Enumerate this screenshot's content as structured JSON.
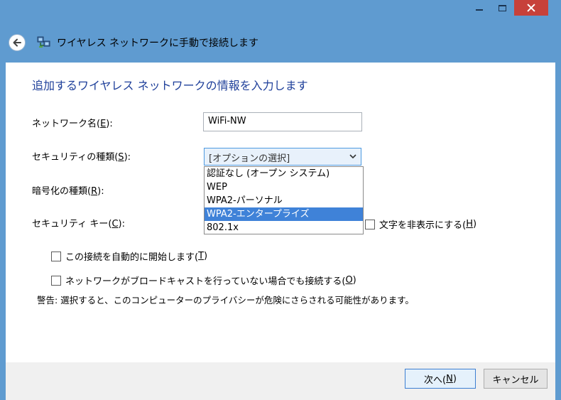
{
  "window": {
    "title": "ワイヤレス ネットワークに手動で接続します"
  },
  "content": {
    "heading": "追加するワイヤレス ネットワークの情報を入力します",
    "network_name": {
      "label_pre": "ネットワーク名(",
      "mnemonic": "E",
      "label_post": "):",
      "value": "WiFi-NW"
    },
    "security_type": {
      "label_pre": "セキュリティの種類(",
      "mnemonic": "S",
      "label_post": "):",
      "value": "[オプションの選択]",
      "options": [
        "認証なし (オープン システム)",
        "WEP",
        "WPA2-パーソナル",
        "WPA2-エンタープライズ",
        "802.1x"
      ],
      "highlighted_index": 3
    },
    "encryption_type": {
      "label_pre": "暗号化の種類(",
      "mnemonic": "R",
      "label_post": "):"
    },
    "security_key": {
      "label_pre": "セキュリティ キー(",
      "mnemonic": "C",
      "label_post": "):"
    },
    "hide_chars": {
      "label_pre": "文字を非表示にする(",
      "mnemonic": "H",
      "label_post": ")",
      "checked": false
    },
    "auto_start": {
      "label_pre": "この接続を自動的に開始します(",
      "mnemonic": "T",
      "label_post": ")",
      "checked": false
    },
    "connect_hidden": {
      "label_pre": "ネットワークがブロードキャストを行っていない場合でも接続する(",
      "mnemonic": "O",
      "label_post": ")",
      "checked": false
    },
    "warning": "警告: 選択すると、このコンピューターのプライバシーが危険にさらされる可能性があります。"
  },
  "footer": {
    "next": {
      "label_pre": "次へ(",
      "mnemonic": "N",
      "label_post": ")"
    },
    "cancel": "キャンセル"
  },
  "colors": {
    "frame": "#5f9bd0",
    "heading": "#1e3f9a",
    "selection": "#3f82d8",
    "close_button": "#c7413a"
  },
  "icons": [
    "back-arrow-icon",
    "network-icon",
    "minimize-icon",
    "maximize-icon",
    "close-icon",
    "chevron-down-icon"
  ]
}
